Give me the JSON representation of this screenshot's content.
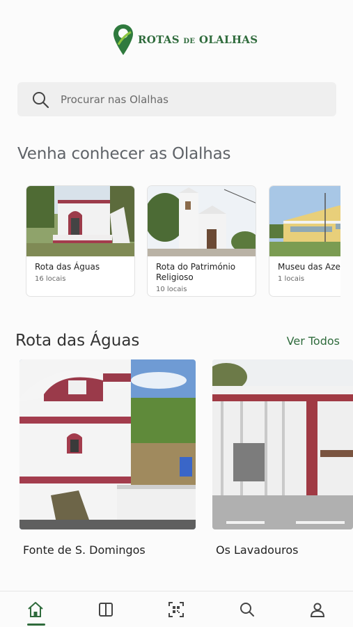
{
  "app": {
    "logo_main": "ROTAS",
    "logo_de": "DE",
    "logo_place": "OLALHAS",
    "brand_color": "#2f6b3c"
  },
  "search": {
    "placeholder": "Procurar nas Olalhas",
    "icon": "search-icon"
  },
  "discover": {
    "title": "Venha conhecer as Olalhas",
    "cards": [
      {
        "title": "Rota das Águas",
        "count": "16 locais"
      },
      {
        "title": "Rota do Património Religioso",
        "count": "10 locais"
      },
      {
        "title": "Museu das Azer",
        "count": "1 locais"
      }
    ]
  },
  "route": {
    "title": "Rota das Águas",
    "see_all": "Ver Todos",
    "items": [
      {
        "name": "Fonte de S. Domingos"
      },
      {
        "name": "Os Lavadouros"
      }
    ]
  },
  "bottom_nav": {
    "items": [
      {
        "icon": "home-icon",
        "active": true
      },
      {
        "icon": "book-icon",
        "active": false
      },
      {
        "icon": "qr-scan-icon",
        "active": false
      },
      {
        "icon": "search-icon",
        "active": false
      },
      {
        "icon": "profile-icon",
        "active": false
      }
    ]
  }
}
